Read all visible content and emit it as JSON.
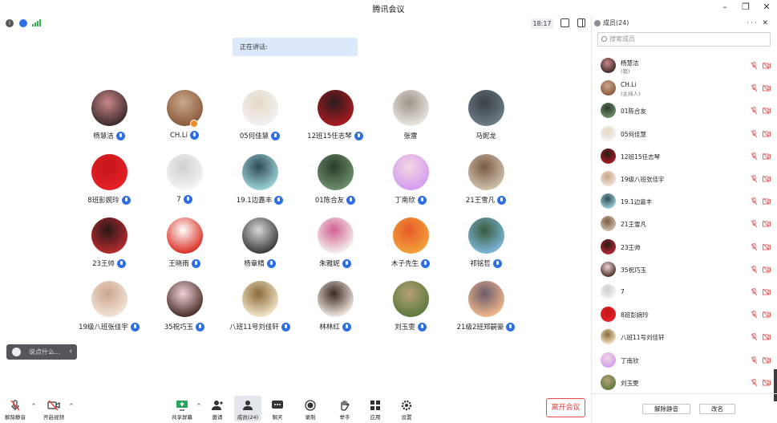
{
  "window": {
    "title": "腾讯会议",
    "controls": [
      "–",
      "❐",
      "✕"
    ]
  },
  "topbar": {
    "clock": "18:17"
  },
  "speaking": {
    "label": "正在讲话:"
  },
  "participants": [
    {
      "name": "杨慧洁",
      "mic": true,
      "colors": [
        "#3d2a2a",
        "#c9878a"
      ]
    },
    {
      "name": "CH.Li",
      "mic": true,
      "host": true,
      "colors": [
        "#8b5a3c",
        "#c9a98a"
      ]
    },
    {
      "name": "05何佳慧",
      "mic": true,
      "colors": [
        "#f2f2f2",
        "#e6d7c4"
      ]
    },
    {
      "name": "12班15任志琴",
      "mic": true,
      "colors": [
        "#a81b21",
        "#2a1b1b"
      ]
    },
    {
      "name": "张雷",
      "mic": false,
      "colors": [
        "#e8e4df",
        "#9e948a"
      ]
    },
    {
      "name": "马妮龙",
      "mic": false,
      "colors": [
        "#6b7c85",
        "#3a4045"
      ]
    },
    {
      "name": "8班彭婉玲",
      "mic": true,
      "colors": [
        "#e52126",
        "#c3151b"
      ]
    },
    {
      "name": "7",
      "mic": true,
      "colors": [
        "#f4f4f4",
        "#cfcfcf"
      ]
    },
    {
      "name": "19.1边嘉丰",
      "mic": true,
      "colors": [
        "#9bd1d8",
        "#2e4a56"
      ]
    },
    {
      "name": "01陈合友",
      "mic": true,
      "colors": [
        "#6c8f6b",
        "#2b3b2b"
      ]
    },
    {
      "name": "丁南欣",
      "mic": true,
      "colors": [
        "#d49cf1",
        "#f3d8e0"
      ]
    },
    {
      "name": "21王雪凡",
      "mic": true,
      "colors": [
        "#cfc0ac",
        "#7a5a45"
      ]
    },
    {
      "name": "23王帅",
      "mic": true,
      "colors": [
        "#b32a2f",
        "#2a1818"
      ]
    },
    {
      "name": "王晓雨",
      "mic": true,
      "colors": [
        "#d93025",
        "#ffffff"
      ]
    },
    {
      "name": "杨章精",
      "mic": true,
      "colors": [
        "#3a3a3a",
        "#d8d8d8"
      ]
    },
    {
      "name": "朱雅妮",
      "mic": true,
      "colors": [
        "#f4f1ec",
        "#d06090"
      ]
    },
    {
      "name": "木子先生",
      "mic": true,
      "colors": [
        "#f2a03a",
        "#e85a2a"
      ]
    },
    {
      "name": "祁铭哲",
      "mic": true,
      "colors": [
        "#7bb6d8",
        "#3a5a3a"
      ]
    },
    {
      "name": "19级八班张佳宇",
      "mic": true,
      "colors": [
        "#f2e3d6",
        "#caa58c"
      ]
    },
    {
      "name": "35祝巧玉",
      "mic": true,
      "colors": [
        "#4a2f2a",
        "#f1d3d8"
      ]
    },
    {
      "name": "八班11号刘佳轩",
      "mic": true,
      "colors": [
        "#f1e4c6",
        "#8a6a3a"
      ]
    },
    {
      "name": "林林红",
      "mic": true,
      "colors": [
        "#efe7df",
        "#3a2a22"
      ]
    },
    {
      "name": "刘玉雯",
      "mic": true,
      "colors": [
        "#5c7a3c",
        "#b6a07a"
      ]
    },
    {
      "name": "21级2班郑嗣豪",
      "mic": true,
      "colors": [
        "#f0b78c",
        "#6a5a6a"
      ]
    }
  ],
  "chat": {
    "placeholder": "说点什么...",
    "arrow": "‹"
  },
  "toolbar": {
    "mute": "解除静音",
    "video": "开启视频",
    "share": "共享屏幕",
    "invite": "邀请",
    "members": "成员(24)",
    "chat": "聊天",
    "record": "录制",
    "hand": "举手",
    "apps": "应用",
    "settings": "设置",
    "leave": "离开会议"
  },
  "panel": {
    "title": "成员(24)",
    "menu": "···  ✕",
    "search_placeholder": "搜索成员",
    "members": [
      {
        "name": "杨慧洁",
        "role": "(我)"
      },
      {
        "name": "CH.Li",
        "role": "(主持人)"
      },
      {
        "name": "01陈合友",
        "role": ""
      },
      {
        "name": "05何佳慧",
        "role": ""
      },
      {
        "name": "12班15任志琴",
        "role": ""
      },
      {
        "name": "19级八班张佳宇",
        "role": ""
      },
      {
        "name": "19.1边嘉丰",
        "role": ""
      },
      {
        "name": "21王雪凡",
        "role": ""
      },
      {
        "name": "23王帅",
        "role": ""
      },
      {
        "name": "35祝巧玉",
        "role": ""
      },
      {
        "name": "7",
        "role": ""
      },
      {
        "name": "8班彭婉玲",
        "role": ""
      },
      {
        "name": "八班11号刘佳轩",
        "role": ""
      },
      {
        "name": "丁南欣",
        "role": ""
      },
      {
        "name": "刘玉雯",
        "role": ""
      }
    ],
    "unmute_all": "解除静音",
    "rename": "改名"
  },
  "colors": {
    "accent": "#2f6fe4",
    "danger": "#e93c3c",
    "muted_icon": "#e56a6a"
  }
}
